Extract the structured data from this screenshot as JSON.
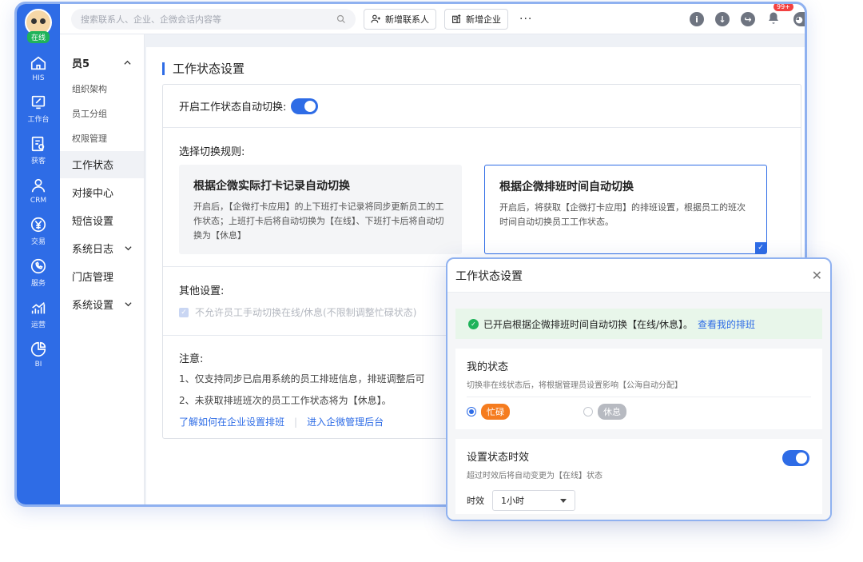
{
  "leftbar": {
    "status": "在线",
    "items": [
      {
        "label": "HIS",
        "icon": "home-icon"
      },
      {
        "label": "工作台",
        "icon": "workbench-icon"
      },
      {
        "label": "获客",
        "icon": "acquire-icon"
      },
      {
        "label": "CRM",
        "icon": "user-icon"
      },
      {
        "label": "交易",
        "icon": "yen-icon"
      },
      {
        "label": "服务",
        "icon": "phone-icon"
      },
      {
        "label": "运营",
        "icon": "chart-icon"
      },
      {
        "label": "BI",
        "icon": "pie-icon"
      }
    ]
  },
  "topbar": {
    "search_placeholder": "搜索联系人、企业、企微会话内容等",
    "add_contact": "新增联系人",
    "add_company": "新增企业",
    "more": "···",
    "badge": "99+"
  },
  "sidemenu": {
    "group": "员5",
    "subs": [
      "组织架构",
      "员工分组",
      "权限管理",
      "工作状态"
    ],
    "mains": [
      {
        "label": "对接中心",
        "chevron": false
      },
      {
        "label": "短信设置",
        "chevron": false
      },
      {
        "label": "系统日志",
        "chevron": true
      },
      {
        "label": "门店管理",
        "chevron": false
      },
      {
        "label": "系统设置",
        "chevron": true
      }
    ]
  },
  "content": {
    "title": "工作状态设置",
    "toggle_label": "开启工作状态自动切换:",
    "rules_label": "选择切换规则:",
    "rule1_title": "根据企微实际打卡记录自动切换",
    "rule1_desc": "开启后，【企微打卡应用】的上下班打卡记录将同步更新员工的工作状态；上班打卡后将自动切换为【在线】、下班打卡后将自动切换为【休息】",
    "rule2_title": "根据企微排班时间自动切换",
    "rule2_desc": "开启后，将获取【企微打卡应用】的排班设置，根据员工的班次时间自动切换员工工作状态。",
    "other_label": "其他设置:",
    "other_option": "不允许员工手动切换在线/休息(不限制调整忙碌状态)",
    "note_title": "注意:",
    "note1": "1、仅支持同步已启用系统的员工排班信息，排班调整后可",
    "note2": "2、未获取排班班次的员工工作状态将为【休息】。",
    "link1": "了解如何在企业设置排班",
    "link_sep": "|",
    "link2": "进入企微管理后台"
  },
  "dialog": {
    "title": "工作状态设置",
    "notice": "已开启根据企微排班时间自动切换【在线/休息】。",
    "notice_link": "查看我的排班",
    "my_status_title": "我的状态",
    "my_status_sub": "切换非在线状态后，将根据管理员设置影响【公海自动分配】",
    "opt_busy": "忙碌",
    "opt_rest": "休息",
    "timing_title": "设置状态时效",
    "timing_sub": "超过时效后将自动变更为【在线】状态",
    "duration_label": "时效",
    "duration_value": "1小时"
  },
  "colors": {
    "primary": "#2e6ce6",
    "success": "#1fb35a",
    "busy": "#f57c1f",
    "rest": "#b7bac1"
  }
}
